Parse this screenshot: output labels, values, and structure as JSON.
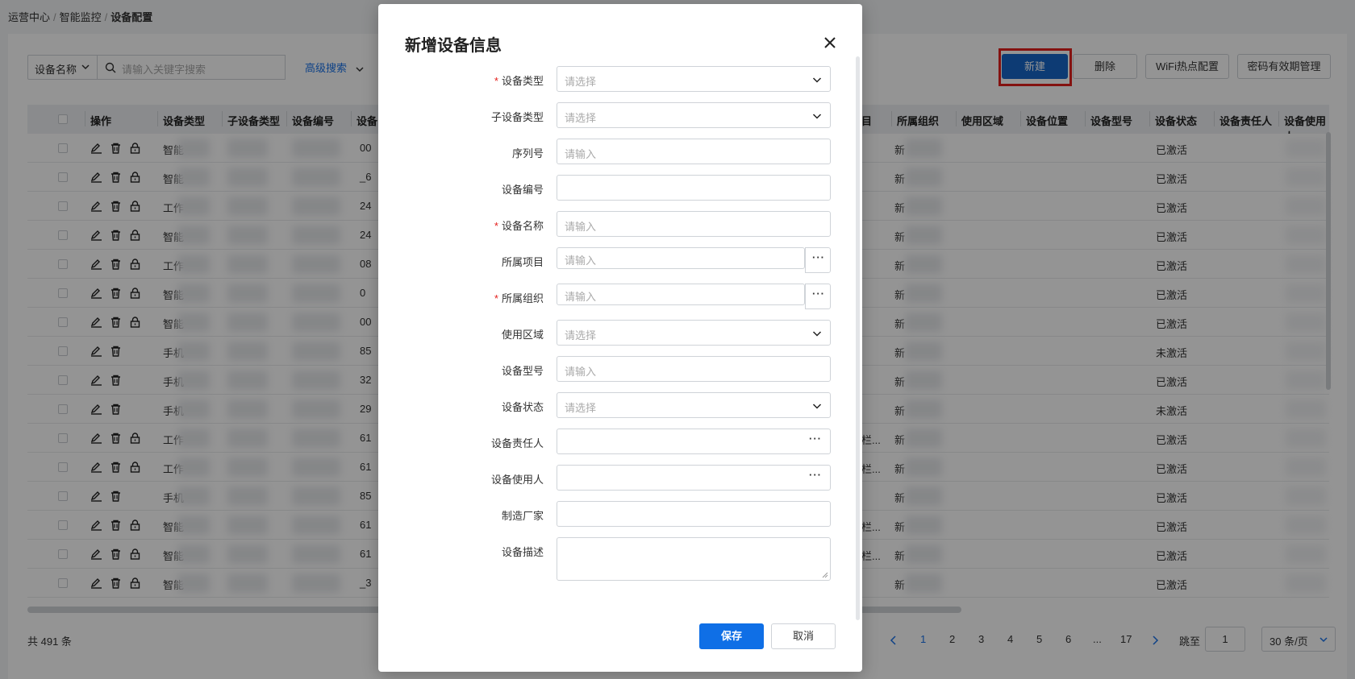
{
  "breadcrumb": [
    "运营中心",
    "智能监控",
    "设备配置"
  ],
  "toolbar": {
    "field_select": "设备名称",
    "search_placeholder": "请输入关键字搜索",
    "advanced": "高级搜索",
    "buttons": [
      "新建",
      "删除",
      "WiFi热点配置",
      "密码有效期管理"
    ]
  },
  "table": {
    "columns": [
      "操作",
      "设备类型",
      "子设备类型",
      "设备编号",
      "设备",
      "目",
      "所属组织",
      "使用区域",
      "设备位置",
      "设备型号",
      "设备状态",
      "设备责任人",
      "设备使用人"
    ],
    "rows": [
      {
        "type": "智能",
        "code": "00",
        "org": "新",
        "status": "已激活",
        "lock": true
      },
      {
        "type": "智能",
        "code": "_6",
        "org": "新",
        "status": "已激活",
        "lock": true
      },
      {
        "type": "工作",
        "code": "24",
        "org": "新",
        "status": "已激活",
        "lock": true
      },
      {
        "type": "智能",
        "code": "24",
        "org": "新",
        "status": "已激活",
        "lock": true
      },
      {
        "type": "工作",
        "code": "08",
        "org": "新",
        "status": "已激活",
        "lock": true
      },
      {
        "type": "智能",
        "code": "0",
        "org": "新",
        "status": "已激活",
        "lock": true
      },
      {
        "type": "智能",
        "code": "00",
        "org": "新",
        "status": "已激活",
        "lock": true
      },
      {
        "type": "手机",
        "code": "85",
        "org": "新",
        "status": "未激活",
        "lock": false
      },
      {
        "type": "手机",
        "code": "32",
        "org": "新",
        "status": "已激活",
        "lock": false
      },
      {
        "type": "手机",
        "code": "29",
        "org": "新",
        "status": "未激活",
        "lock": false
      },
      {
        "type": "工作",
        "code": "61",
        "col5": "栏...",
        "org": "新",
        "status": "已激活",
        "lock": true
      },
      {
        "type": "工作",
        "code": "61",
        "col5": "栏...",
        "org": "新",
        "status": "已激活",
        "lock": true
      },
      {
        "type": "手机",
        "code": "85",
        "org": "新",
        "status": "已激活",
        "lock": false
      },
      {
        "type": "智能",
        "code": "61",
        "col5": "栏...",
        "org": "新",
        "status": "已激活",
        "lock": true
      },
      {
        "type": "智能",
        "code": "61",
        "col5": "栏...",
        "org": "新",
        "status": "已激活",
        "lock": true
      },
      {
        "type": "智能",
        "code": "_3",
        "org": "新",
        "status": "已激活",
        "lock": true
      }
    ]
  },
  "pagination": {
    "total": "共 491 条",
    "pages": [
      "1",
      "2",
      "3",
      "4",
      "5",
      "6",
      "...",
      "17"
    ],
    "current": "1",
    "jump_label": "跳至",
    "jump_value": "1",
    "page_size": "30 条/页"
  },
  "modal": {
    "title": "新增设备信息",
    "fields": [
      {
        "label": "设备类型",
        "required": true,
        "kind": "select",
        "placeholder": "请选择"
      },
      {
        "label": "子设备类型",
        "required": false,
        "kind": "select",
        "placeholder": "请选择"
      },
      {
        "label": "序列号",
        "required": false,
        "kind": "input",
        "placeholder": "请输入"
      },
      {
        "label": "设备编号",
        "required": false,
        "kind": "input",
        "placeholder": ""
      },
      {
        "label": "设备名称",
        "required": true,
        "kind": "input",
        "placeholder": "请输入"
      },
      {
        "label": "所属项目",
        "required": false,
        "kind": "picker",
        "placeholder": "请输入"
      },
      {
        "label": "所属组织",
        "required": true,
        "kind": "picker",
        "placeholder": "请输入"
      },
      {
        "label": "使用区域",
        "required": false,
        "kind": "select",
        "placeholder": "请选择"
      },
      {
        "label": "设备型号",
        "required": false,
        "kind": "input",
        "placeholder": "请输入"
      },
      {
        "label": "设备状态",
        "required": false,
        "kind": "select",
        "placeholder": "请选择"
      },
      {
        "label": "设备责任人",
        "required": false,
        "kind": "lookup",
        "placeholder": ""
      },
      {
        "label": "设备使用人",
        "required": false,
        "kind": "lookup",
        "placeholder": ""
      },
      {
        "label": "制造厂家",
        "required": false,
        "kind": "input",
        "placeholder": ""
      },
      {
        "label": "设备描述",
        "required": false,
        "kind": "textarea",
        "placeholder": ""
      }
    ],
    "save": "保存",
    "cancel": "取消"
  }
}
